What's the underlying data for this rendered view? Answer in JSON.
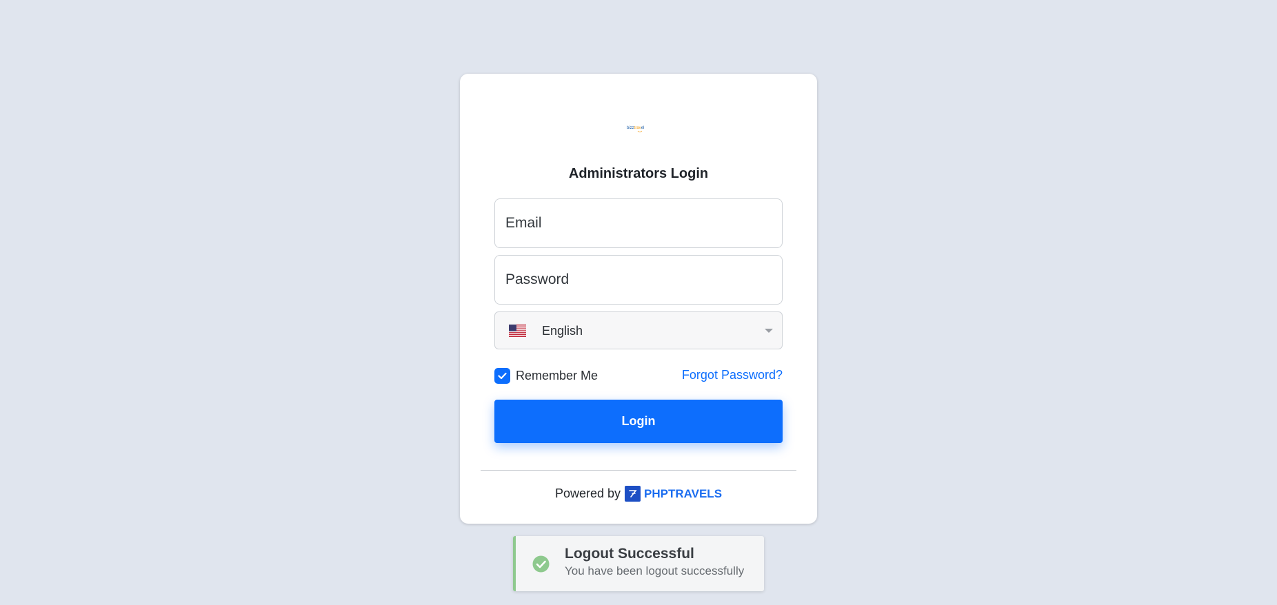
{
  "logo": {
    "text_part1": "bizz",
    "text_part2": "trav",
    "text_part3": "el"
  },
  "login": {
    "title": "Administrators Login",
    "email_placeholder": "Email",
    "password_placeholder": "Password",
    "language": {
      "selected": "English",
      "flag_icon": "us-flag-icon"
    },
    "remember_label": "Remember Me",
    "remember_checked": true,
    "forgot_label": "Forgot Password?",
    "login_button": "Login",
    "powered_by": "Powered by",
    "brand": "PHPTRAVELS"
  },
  "toast": {
    "title": "Logout Successful",
    "message": "You have been logout successfully",
    "icon": "check-circle-icon"
  },
  "colors": {
    "background": "#e0e5ee",
    "primary": "#0d6efd",
    "success": "#8ec98e"
  }
}
